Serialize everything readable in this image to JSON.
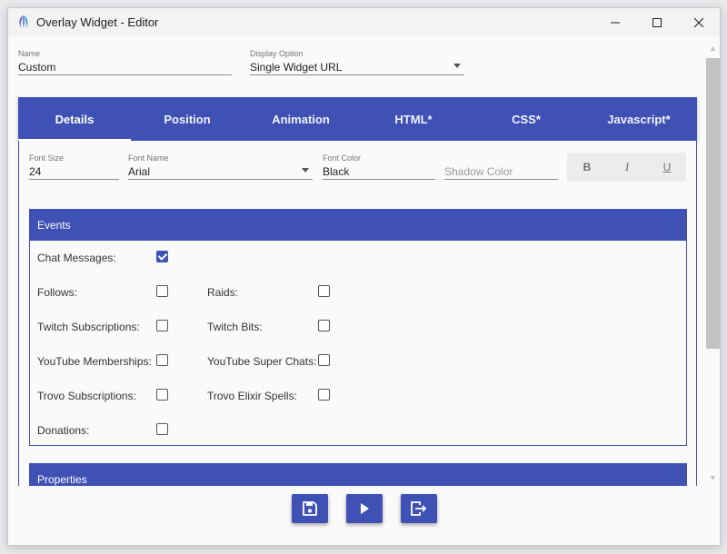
{
  "window": {
    "title": "Overlay Widget - Editor"
  },
  "form": {
    "name": {
      "label": "Name",
      "value": "Custom"
    },
    "display_option": {
      "label": "Display Option",
      "value": "Single Widget URL"
    }
  },
  "tabs": [
    {
      "label": "Details",
      "active": true
    },
    {
      "label": "Position",
      "active": false
    },
    {
      "label": "Animation",
      "active": false
    },
    {
      "label": "HTML*",
      "active": false
    },
    {
      "label": "CSS*",
      "active": false
    },
    {
      "label": "Javascript*",
      "active": false
    }
  ],
  "details": {
    "font_size": {
      "label": "Font Size",
      "value": "24"
    },
    "font_name": {
      "label": "Font Name",
      "value": "Arial"
    },
    "font_color": {
      "label": "Font Color",
      "value": "Black"
    },
    "shadow_color": {
      "placeholder": "Shadow Color"
    },
    "format": {
      "bold": "B",
      "italic": "I",
      "underline": "U"
    }
  },
  "events": {
    "header": "Events",
    "items": [
      {
        "label": "Chat Messages:",
        "checked": true
      },
      {
        "label": "Follows:",
        "checked": false
      },
      {
        "label": "Raids:",
        "checked": false
      },
      {
        "label": "Twitch Subscriptions:",
        "checked": false
      },
      {
        "label": "Twitch Bits:",
        "checked": false
      },
      {
        "label": "YouTube Memberships:",
        "checked": false
      },
      {
        "label": "YouTube Super Chats:",
        "checked": false
      },
      {
        "label": "Trovo Subscriptions:",
        "checked": false
      },
      {
        "label": "Trovo Elixir Spells:",
        "checked": false
      },
      {
        "label": "Donations:",
        "checked": false
      }
    ]
  },
  "properties": {
    "header": "Properties"
  },
  "footer": {
    "buttons": [
      "save-icon",
      "play-icon",
      "exit-icon"
    ]
  },
  "colors": {
    "accent": "#3f51b5",
    "titlebar": "#f3f3f3",
    "background": "#fafafa"
  }
}
